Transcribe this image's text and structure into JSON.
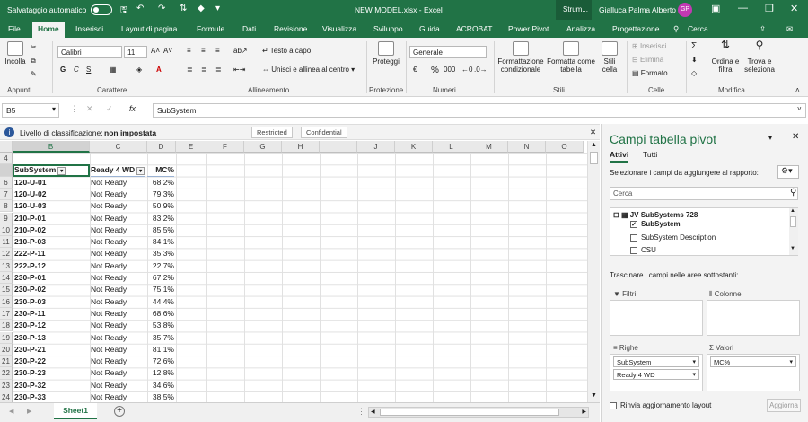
{
  "titlebar": {
    "autosave_label": "Salvataggio automatico",
    "toggle_state": "Off",
    "file_title": "NEW MODEL.xlsx - Excel",
    "context_tab": "Strum...",
    "user_name": "Gialluca Palma Alberto",
    "user_initials": "GP"
  },
  "menu_tabs": [
    "File",
    "Home",
    "Inserisci",
    "Layout di pagina",
    "Formule",
    "Dati",
    "Revisione",
    "Visualizza",
    "Sviluppo",
    "Guida",
    "ACROBAT",
    "Power Pivot",
    "Analizza",
    "Progettazione"
  ],
  "active_tab": "Home",
  "search_label": "Cerca",
  "ribbon": {
    "appunti": {
      "label": "Appunti",
      "paste": "Incolla"
    },
    "carattere": {
      "label": "Carattere",
      "font": "Calibri",
      "size": "11",
      "bold": "G",
      "italic": "C",
      "underline": "S"
    },
    "allineamento": {
      "label": "Allineamento",
      "wrap": "Testo a capo",
      "merge": "Unisci e allinea al centro"
    },
    "protezione": {
      "label": "Protezione",
      "protect": "Proteggi"
    },
    "numeri": {
      "label": "Numeri",
      "format": "Generale",
      "currency": "€",
      "percent": "%",
      "thousands": "000"
    },
    "stili": {
      "label": "Stili",
      "cond": "Formattazione condizionale",
      "table": "Formatta come tabella",
      "cell": "Stili cella"
    },
    "celle": {
      "label": "Celle",
      "insert": "Inserisci",
      "delete": "Elimina",
      "format": "Formato"
    },
    "modifica": {
      "label": "Modifica",
      "sort": "Ordina e filtra",
      "find": "Trova e seleziona",
      "sum": "Σ"
    }
  },
  "formula_bar": {
    "name_box": "B5",
    "fx": "fx",
    "content": "SubSystem"
  },
  "classification": {
    "label": "Livello di classificazione:",
    "value": "non impostata",
    "buttons": [
      "Restricted",
      "Confidential"
    ]
  },
  "columns": [
    "B",
    "C",
    "D",
    "E",
    "F",
    "G",
    "H",
    "I",
    "J",
    "K",
    "L",
    "M",
    "N",
    "O"
  ],
  "header_row": {
    "row": "5",
    "b": "SubSystem",
    "c": "Ready 4 WD",
    "d": "MC%"
  },
  "rows": [
    {
      "r": "6",
      "b": "120-U-01",
      "c": "Not Ready",
      "d": "68,2%"
    },
    {
      "r": "7",
      "b": "120-U-02",
      "c": "Not Ready",
      "d": "79,3%"
    },
    {
      "r": "8",
      "b": "120-U-03",
      "c": "Not Ready",
      "d": "50,9%"
    },
    {
      "r": "9",
      "b": "210-P-01",
      "c": "Not Ready",
      "d": "83,2%"
    },
    {
      "r": "10",
      "b": "210-P-02",
      "c": "Not Ready",
      "d": "85,5%"
    },
    {
      "r": "11",
      "b": "210-P-03",
      "c": "Not Ready",
      "d": "84,1%"
    },
    {
      "r": "12",
      "b": "222-P-11",
      "c": "Not Ready",
      "d": "35,3%"
    },
    {
      "r": "13",
      "b": "222-P-12",
      "c": "Not Ready",
      "d": "22,7%"
    },
    {
      "r": "14",
      "b": "230-P-01",
      "c": "Not Ready",
      "d": "67,2%"
    },
    {
      "r": "15",
      "b": "230-P-02",
      "c": "Not Ready",
      "d": "75,1%"
    },
    {
      "r": "16",
      "b": "230-P-03",
      "c": "Not Ready",
      "d": "44,4%"
    },
    {
      "r": "17",
      "b": "230-P-11",
      "c": "Not Ready",
      "d": "68,6%"
    },
    {
      "r": "18",
      "b": "230-P-12",
      "c": "Not Ready",
      "d": "53,8%"
    },
    {
      "r": "19",
      "b": "230-P-13",
      "c": "Not Ready",
      "d": "35,7%"
    },
    {
      "r": "20",
      "b": "230-P-21",
      "c": "Not Ready",
      "d": "81,1%"
    },
    {
      "r": "21",
      "b": "230-P-22",
      "c": "Not Ready",
      "d": "72,6%"
    },
    {
      "r": "22",
      "b": "230-P-23",
      "c": "Not Ready",
      "d": "12,8%"
    },
    {
      "r": "23",
      "b": "230-P-32",
      "c": "Not Ready",
      "d": "34,6%"
    },
    {
      "r": "24",
      "b": "230-P-33",
      "c": "Not Ready",
      "d": "38,5%"
    }
  ],
  "row4": "4",
  "sheet_tab": "Sheet1",
  "pivot": {
    "title": "Campi tabella pivot",
    "tabs": [
      "Attivi",
      "Tutti"
    ],
    "choose_label": "Selezionare i campi da aggiungere al rapporto:",
    "search_placeholder": "Cerca",
    "table_name": "JV SubSystems 728",
    "fields": [
      {
        "name": "SubSystem",
        "checked": true
      },
      {
        "name": "SubSystem Description",
        "checked": false
      },
      {
        "name": "CSU",
        "checked": false
      }
    ],
    "drag_label": "Trascinare i campi nelle aree sottostanti:",
    "areas": {
      "filters": "Filtri",
      "columns": "Colonne",
      "rows": "Righe",
      "values": "Valori"
    },
    "row_items": [
      "SubSystem",
      "Ready 4 WD"
    ],
    "value_items": [
      "MC%"
    ],
    "defer_label": "Rinvia aggiornamento layout",
    "update_button": "Aggiorna"
  }
}
